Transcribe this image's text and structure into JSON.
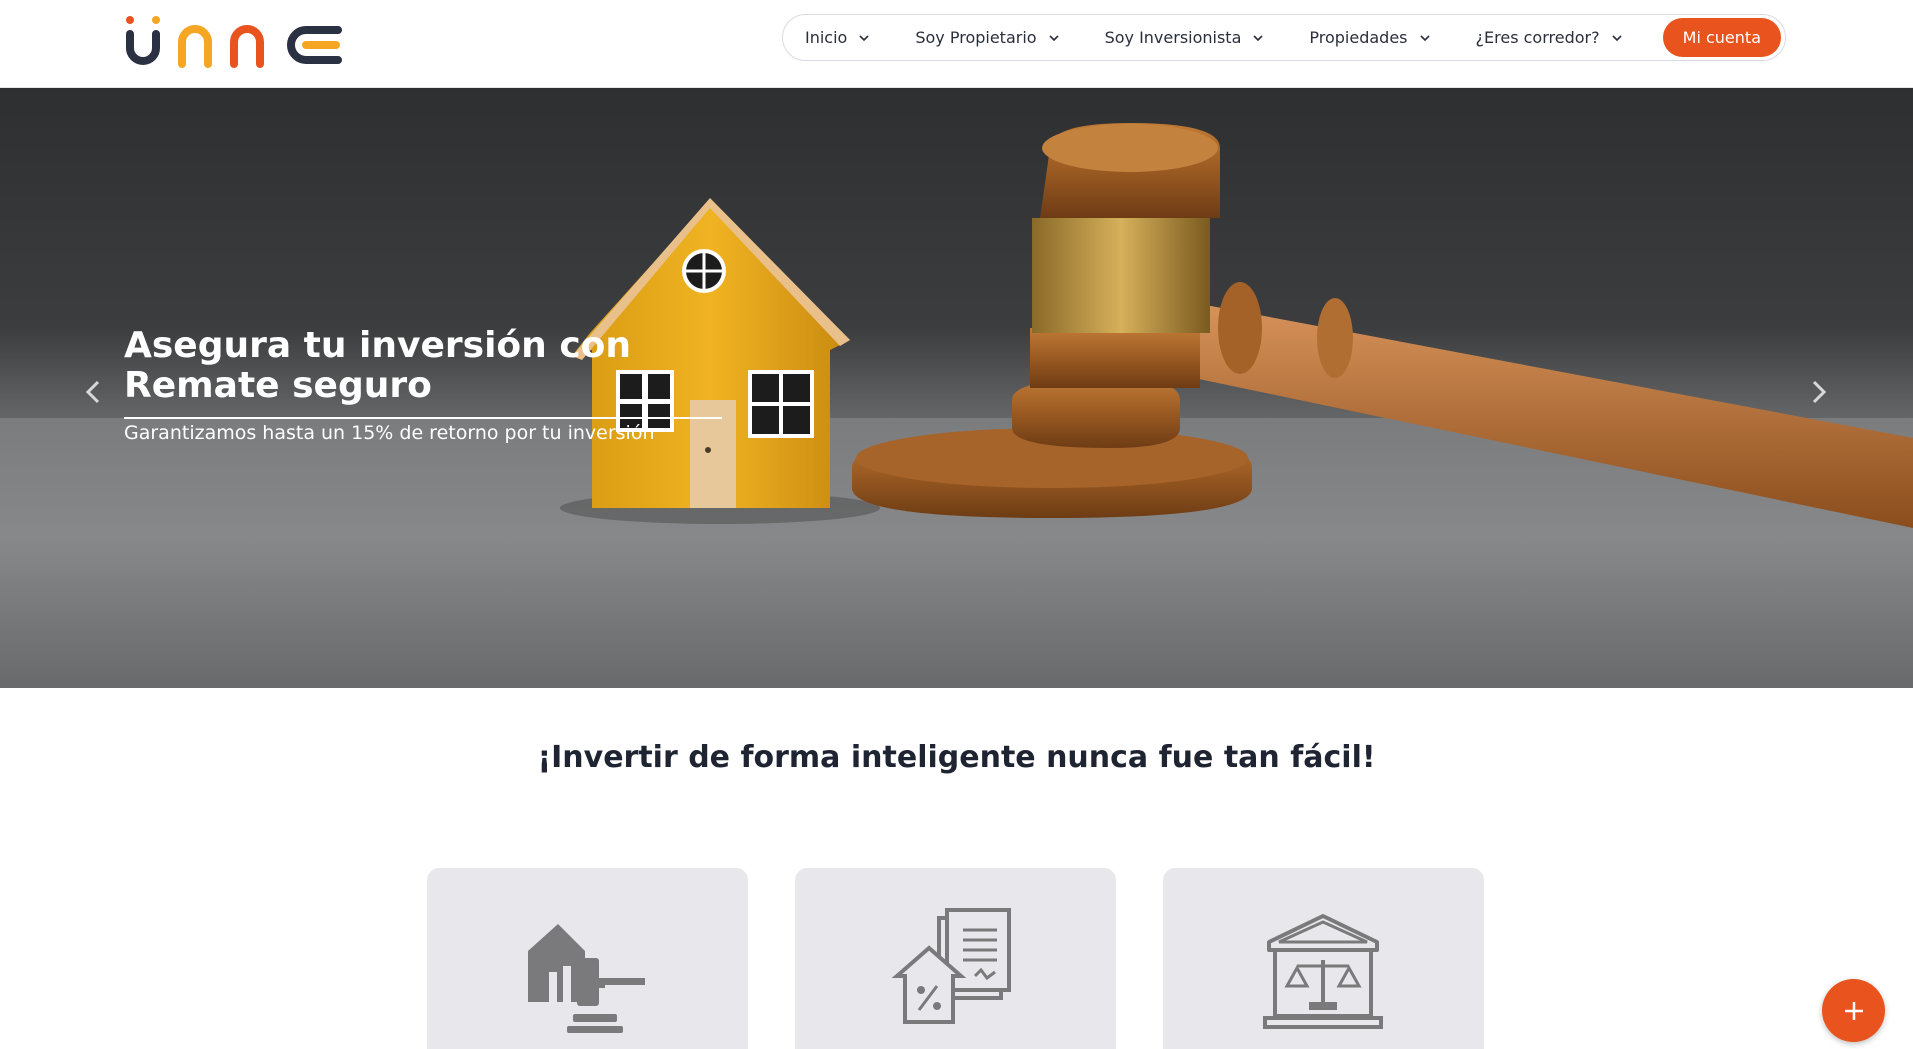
{
  "brand": {
    "logo_text": "unne",
    "accent_color": "#e8531e",
    "logo_colors": [
      "#2a3142",
      "#f5a623",
      "#e8531e"
    ]
  },
  "nav": {
    "items": [
      {
        "label": "Inicio"
      },
      {
        "label": "Soy Propietario"
      },
      {
        "label": "Soy Inversionista"
      },
      {
        "label": "Propiedades"
      },
      {
        "label": "¿Eres corredor?"
      }
    ],
    "account_label": "Mi cuenta"
  },
  "hero": {
    "title_line1": "Asegura tu inversión con",
    "title_line2": "Remate seguro",
    "subtitle": "Garantizamos hasta un 15% de retorno por tu inversión"
  },
  "section": {
    "title": "¡Invertir de forma inteligente nunca fue tan fácil!"
  },
  "cards": [
    {
      "icon": "house-gavel-icon"
    },
    {
      "icon": "house-percent-document-icon"
    },
    {
      "icon": "bank-scales-icon"
    }
  ],
  "fab": {
    "icon": "plus-icon"
  }
}
